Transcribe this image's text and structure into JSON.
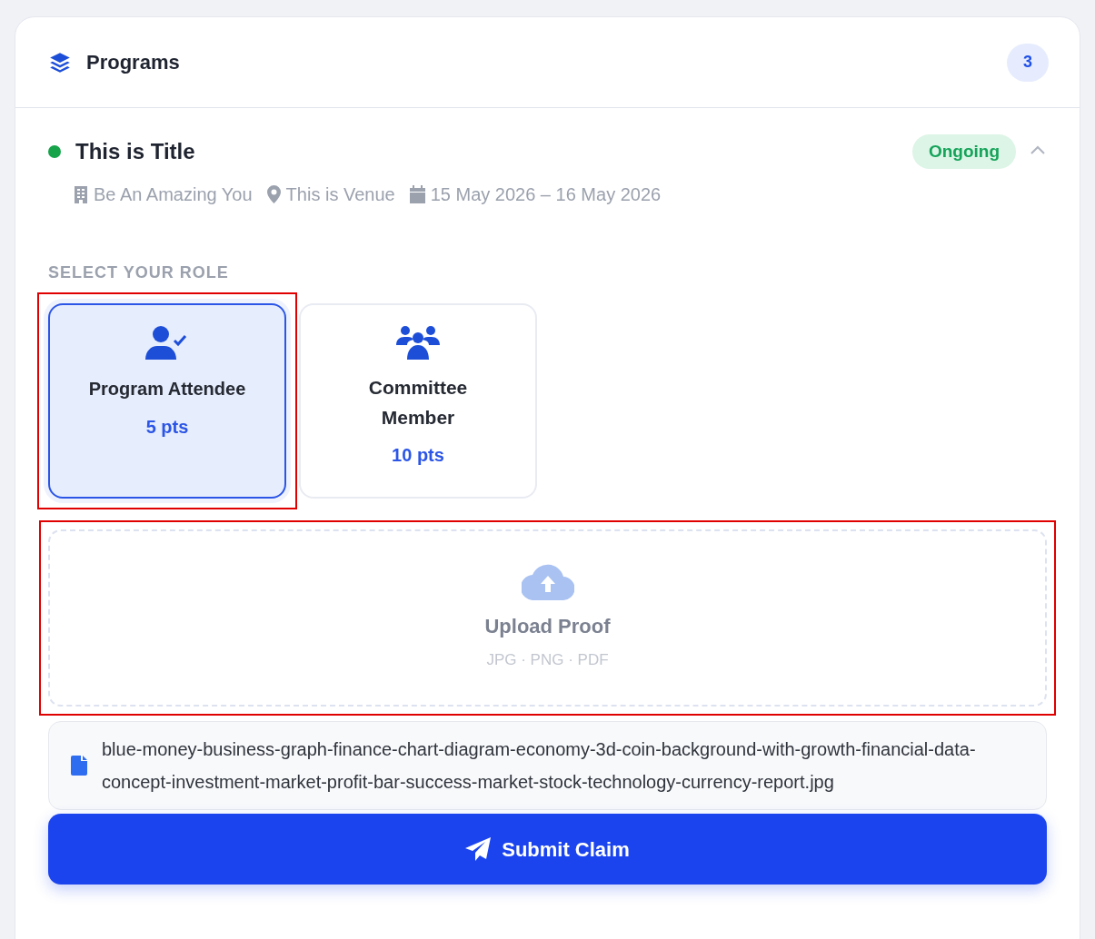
{
  "header": {
    "title": "Programs",
    "count": "3"
  },
  "program": {
    "title": "This is Title",
    "status": "Ongoing",
    "expanded": true,
    "organizer": "Be An Amazing You",
    "venue": "This is Venue",
    "dates": "15 May 2026 – 16 May 2026"
  },
  "role_label": "SELECT YOUR ROLE",
  "roles": [
    {
      "kind": "attendee",
      "label": "Program Attendee",
      "points": "5 pts",
      "selected": true,
      "highlighted": true
    },
    {
      "kind": "committee",
      "label": "Committee Member",
      "points": "10 pts",
      "selected": false,
      "highlighted": false
    }
  ],
  "upload": {
    "title": "Upload Proof",
    "formats": "JPG · PNG · PDF",
    "highlighted": true
  },
  "file": {
    "name": "blue-money-business-graph-finance-chart-diagram-economy-3d-coin-background-with-growth-financial-data-concept-investment-market-profit-bar-success-market-stock-technology-currency-report.jpg"
  },
  "submit": {
    "label": "Submit Claim"
  }
}
